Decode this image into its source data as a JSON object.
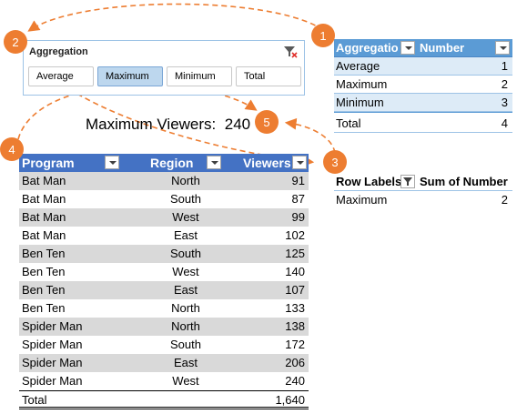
{
  "slicer": {
    "title": "Aggregation",
    "buttons": [
      {
        "label": "Average",
        "selected": false
      },
      {
        "label": "Maximum",
        "selected": true
      },
      {
        "label": "Minimum",
        "selected": false
      },
      {
        "label": "Total",
        "selected": false
      }
    ]
  },
  "agg_table": {
    "headers": [
      "Aggregatio",
      "Number"
    ],
    "rows": [
      {
        "label": "Average",
        "value": "1"
      },
      {
        "label": "Maximum",
        "value": "2"
      },
      {
        "label": "Minimum",
        "value": "3"
      }
    ],
    "total": {
      "label": "Total",
      "value": "4"
    }
  },
  "pivot": {
    "headers": [
      "Row Labels",
      "Sum of Number"
    ],
    "rows": [
      {
        "label": "Maximum",
        "value": "2"
      }
    ]
  },
  "measure": {
    "label": "Maximum Viewers:",
    "value": "240"
  },
  "main_table": {
    "headers": [
      "Program",
      "Region",
      "Viewers"
    ],
    "rows": [
      {
        "program": "Bat Man",
        "region": "North",
        "viewers": "91"
      },
      {
        "program": "Bat Man",
        "region": "South",
        "viewers": "87"
      },
      {
        "program": "Bat Man",
        "region": "West",
        "viewers": "99"
      },
      {
        "program": "Bat Man",
        "region": "East",
        "viewers": "102"
      },
      {
        "program": "Ben Ten",
        "region": "South",
        "viewers": "125"
      },
      {
        "program": "Ben Ten",
        "region": "West",
        "viewers": "140"
      },
      {
        "program": "Ben Ten",
        "region": "East",
        "viewers": "107"
      },
      {
        "program": "Ben Ten",
        "region": "North",
        "viewers": "133"
      },
      {
        "program": "Spider Man",
        "region": "North",
        "viewers": "138"
      },
      {
        "program": "Spider Man",
        "region": "South",
        "viewers": "172"
      },
      {
        "program": "Spider Man",
        "region": "East",
        "viewers": "206"
      },
      {
        "program": "Spider Man",
        "region": "West",
        "viewers": "240"
      }
    ],
    "total": {
      "label": "Total",
      "value": "1,640"
    }
  },
  "badges": [
    "1",
    "2",
    "3",
    "4",
    "5"
  ],
  "colors": {
    "accent": "#ed7d31",
    "table_header": "#4472c4",
    "pivot_header": "#5b9bd5",
    "slicer_selected": "#bdd7ee",
    "band_gray": "#d9d9d9",
    "band_blue": "#ddebf7"
  }
}
